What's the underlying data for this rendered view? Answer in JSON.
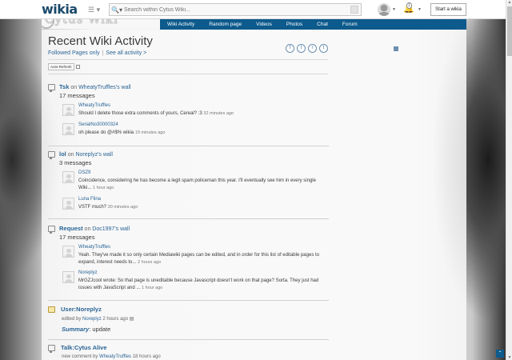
{
  "global_nav": {
    "logo": "wikia",
    "search_placeholder": "Search within Cytus Wiki...",
    "start_wikia": "Start a wikia",
    "notif_count": "1"
  },
  "wiki": {
    "title": "Cytus Wiki",
    "nav": [
      "Wiki Activity",
      "Random page",
      "Videos",
      "Photos",
      "Chat",
      "Forum"
    ]
  },
  "page": {
    "title": "Recent Wiki Activity",
    "followed": "Followed Pages only",
    "see_all": "See all activity >",
    "auto_refresh": "Auto-Refresh",
    "share_icons": [
      "f",
      "t",
      "r",
      "t"
    ]
  },
  "activities": [
    {
      "title": "Tsk",
      "on": "on",
      "wall": "WheatyTruffles's wall",
      "count": "17 messages",
      "messages": [
        {
          "author": "WheatyTruffles",
          "text": "Should I delete those extra comments of yours, Cereal? :3",
          "ts": "32 minutes ago"
        },
        {
          "author": "SerialNo30000324",
          "text": "oh please do @#$% wikia",
          "ts": "19 minutes ago"
        }
      ]
    },
    {
      "title": "lol",
      "on": "on",
      "wall": "Noreplyz's wall",
      "count": "3 messages",
      "messages": [
        {
          "author": "DSZ9",
          "text": "Coincidence, considering he has become a legit spam policeman this year. I'll eventually see him in every single Wiki...",
          "ts": "1 hour ago"
        },
        {
          "author": "Luna Flina",
          "text": "VSTF much?",
          "ts": "20 minutes ago"
        }
      ]
    },
    {
      "title": "Request",
      "on": "on",
      "wall": "Doc1997's wall",
      "count": "17 messages",
      "messages": [
        {
          "author": "WheatyTruffles",
          "text": "Yeah. They've made it so only certain Mediawiki pages can be edited, and in order for this list of editable pages to expand, interest needs to...",
          "ts": "2 hours ago"
        },
        {
          "author": "Noreplyz",
          "text": "MrGZJcool wrote: So that page is uneditable because Javascript doesn't work on that page? Sorta. They just had issues with JavaScript and ...",
          "ts": "1 hour ago"
        }
      ]
    }
  ],
  "edit_item": {
    "title": "User:Noreplyz",
    "edited_by": "edited by",
    "editor": "Noreplyz",
    "ts": "2 hours ago",
    "summary_label": "Summary",
    "summary_value": ": update"
  },
  "talk_item": {
    "title": "Talk:Cytus Alive",
    "meta_prefix": "new comment by",
    "author": "WheatyTruffles",
    "ts": "18 hours ago"
  }
}
